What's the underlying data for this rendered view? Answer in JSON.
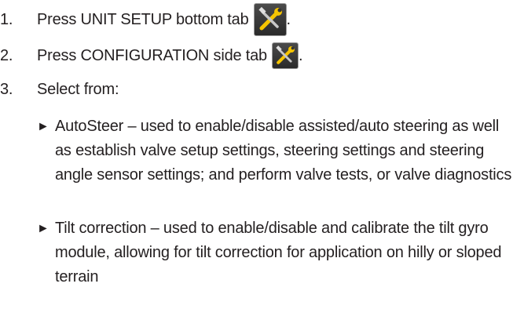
{
  "steps": [
    {
      "number": "1.",
      "text": "Press UNIT SETUP bottom tab",
      "icon": "wrench-screwdriver-icon",
      "suffix": "."
    },
    {
      "number": "2.",
      "text": "Press CONFIGURATION side tab",
      "icon": "wrench-screwdriver-icon",
      "suffix": "."
    },
    {
      "number": "3.",
      "text": "Select from:"
    }
  ],
  "options": [
    {
      "bullet": "►",
      "text": "AutoSteer – used to enable/disable assisted/auto steering as well as establish valve setup settings, steering settings and steering angle sensor settings; and perform valve tests, or valve diagnostics"
    },
    {
      "bullet": "►",
      "text": "Tilt correction – used to enable/disable and calibrate the tilt gyro module, allowing for tilt correction for application on hilly or sloped terrain"
    }
  ],
  "colors": {
    "text": "#231f20",
    "icon_bg": "#333333",
    "icon_yellow": "#f5c400",
    "icon_grey": "#c8c8c8"
  }
}
